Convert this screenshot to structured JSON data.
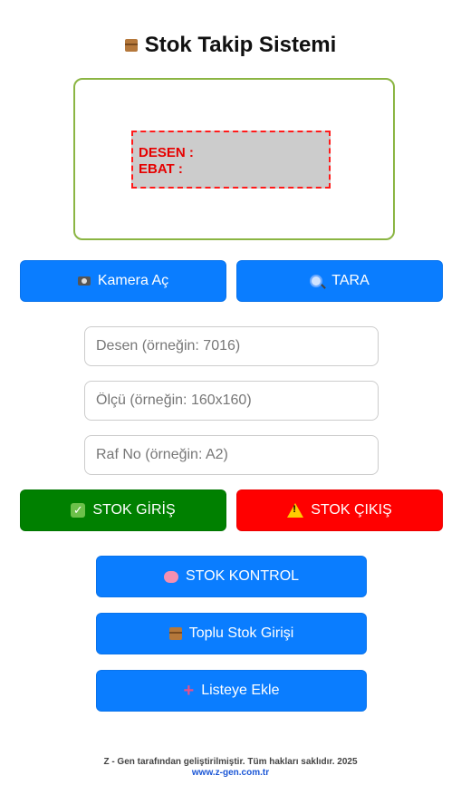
{
  "header": {
    "icon": "package-icon",
    "title": "Stok Takip Sistemi"
  },
  "preview": {
    "desen_label": "DESEN :",
    "ebat_label": "EBAT :"
  },
  "camera_button": {
    "label": "Kamera Aç",
    "icon": "camera-icon"
  },
  "scan_button": {
    "label": "TARA",
    "icon": "magnifier-icon"
  },
  "inputs": {
    "desen": {
      "placeholder": "Desen (örneğin: 7016)",
      "value": ""
    },
    "olcu": {
      "placeholder": "Ölçü (örneğin: 160x160)",
      "value": ""
    },
    "raf": {
      "placeholder": "Raf No (örneğin: A2)",
      "value": ""
    }
  },
  "stock_in_button": {
    "label": "STOK GİRİŞ",
    "icon": "check-icon"
  },
  "stock_out_button": {
    "label": "STOK ÇIKIŞ",
    "icon": "warning-icon"
  },
  "stock_control_button": {
    "label": "STOK KONTROL",
    "icon": "brain-icon"
  },
  "bulk_entry_button": {
    "label": "Toplu Stok Girişi",
    "icon": "package-icon"
  },
  "add_list_button": {
    "label": "Listeye Ekle",
    "icon": "plus-icon"
  },
  "footer": {
    "text": "Z - Gen tarafından geliştirilmiştir. Tüm hakları saklıdır. 2025",
    "link": "www.z-gen.com.tr"
  },
  "colors": {
    "primary": "#0a7dff",
    "success": "#008000",
    "danger": "#ff0000",
    "preview_border": "#8bb543",
    "label_text": "#e60000"
  }
}
